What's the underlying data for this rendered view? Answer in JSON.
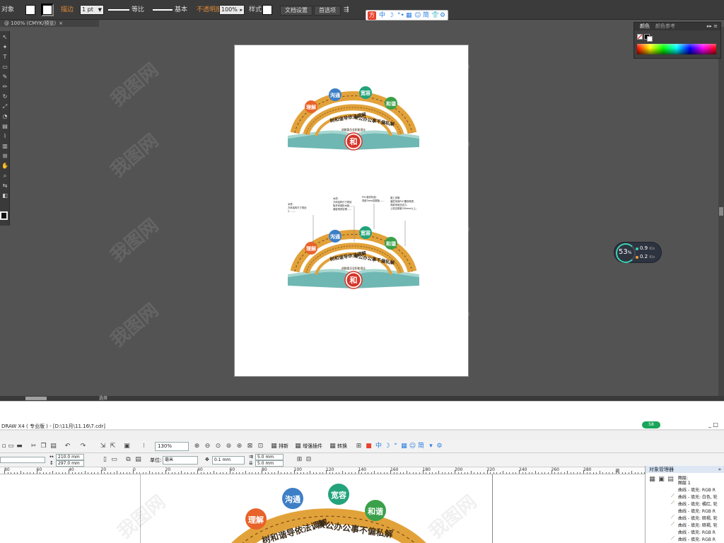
{
  "illustrator": {
    "control_bar": {
      "selection_label": "对象",
      "stroke_label": "描边",
      "stroke_weight": "1 pt",
      "profile_uniform": "等比",
      "brush_basic": "基本",
      "opacity_label": "不透明度",
      "opacity_value": "100%",
      "style_label": "样式",
      "doc_setup_button": "文档设置",
      "preferences_button": "首选项"
    },
    "document_tab": {
      "title": "@ 100% (CMYK/预览)",
      "close": "×"
    },
    "status_text": "选择",
    "color_panel": {
      "tab_color": "颜色",
      "tab_guide": "颜色参考",
      "menu": "▸▸ ≡"
    },
    "floating_toolbar": {
      "logo": "方",
      "items": [
        "中",
        "☽",
        "°•",
        "▦",
        "☺",
        "简",
        "👕",
        "⚙"
      ]
    }
  },
  "artwork": {
    "badges": [
      "理解",
      "沟通",
      "宽容",
      "和谐"
    ],
    "banner_left": "树和谐导依法调解",
    "banner_right": "秉公办公事不偏私解",
    "subtitle": "调解委员会职能理念",
    "center_seal": "和",
    "annotations": [
      {
        "title": "木质：",
        "body": [
          "方体结构尺寸规划",
          "2. ……"
        ]
      },
      {
        "title": "木质：",
        "body": [
          "方体结构尺寸规划",
          "板材采用松木板……",
          "面板喷漆处理……"
        ]
      },
      {
        "title": "PVC板材标准：",
        "body": [
          "背部3mm铝塑板……"
        ]
      },
      {
        "title": "施工说明：",
        "body": [
          "面层采用PVC雕刻喷漆，",
          "背部采用亚克力，",
          "上底边厚度350mm以上。"
        ]
      }
    ]
  },
  "speed_widget": {
    "percent": "53",
    "unit": "%",
    "up": "0.9",
    "up_unit": "K/s",
    "down": "0.2",
    "down_unit": "K/s"
  },
  "coreldraw": {
    "title": "DRAW X4 ( 专业版 ) - [D:\\11月\\11.16\\7.cdr]",
    "badge": "58",
    "window_buttons": "_     □",
    "zoom": "130%",
    "toolbar_labels": {
      "arrange": "排新",
      "enhance": "增强插件",
      "convert": "转换"
    },
    "page_width": "210.0 mm",
    "page_height": "297.0 mm",
    "units_label": "单位:",
    "units_value": "毫米",
    "nudge": "0.1 mm",
    "dup_x": "5.0 mm",
    "dup_y": "5.0 mm",
    "ruler_ticks": [
      "80",
      "60",
      "40",
      "20",
      "0",
      "20",
      "40",
      "60",
      "80",
      "100",
      "120",
      "140",
      "160",
      "180",
      "200",
      "220",
      "240",
      "260",
      "280",
      "毫"
    ],
    "object_manager": {
      "title": "对象管理器",
      "layer_lines": [
        "图层:",
        "图层 1"
      ],
      "rows": [
        "曲线 - 填充: RGB R",
        "曲线 - 填充: 白色, 轮",
        "曲线 - 填充: 橘红, 轮",
        "曲线 - 填充: RGB R",
        "曲线 - 填充: 暗褐, 轮",
        "曲线 - 填充: 暗褐, 轮",
        "曲线 - 填充: RGB R",
        "曲线 - 填充: RGB R"
      ]
    }
  },
  "watermark": "我图网",
  "colors": {
    "badge_orange": "#e8632a",
    "badge_blue": "#3d7fc7",
    "badge_teal": "#23a37c",
    "badge_green": "#3aa14a",
    "arch_gold": "#e2a23a",
    "arch_dark": "#7a4b1c",
    "seal_red": "#d6352a",
    "book_teal": "#6fb7b3"
  }
}
